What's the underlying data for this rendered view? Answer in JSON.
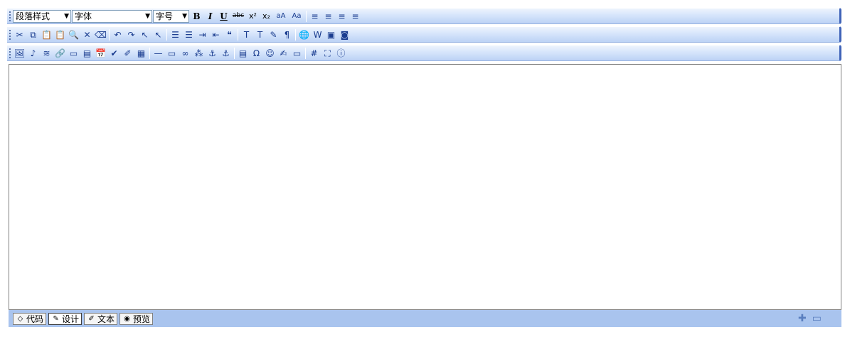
{
  "toolbar1": {
    "paragraph_style": "段落样式",
    "font": "字体",
    "font_size": "字号",
    "buttons": [
      {
        "name": "bold",
        "glyph": "B"
      },
      {
        "name": "italic",
        "glyph": "I"
      },
      {
        "name": "underline",
        "glyph": "U"
      },
      {
        "name": "strikethrough",
        "glyph": "abc"
      },
      {
        "name": "superscript",
        "glyph": "x²"
      },
      {
        "name": "subscript",
        "glyph": "x₂"
      },
      {
        "name": "font-color",
        "glyph": "aA"
      },
      {
        "name": "highlight",
        "glyph": "Aa"
      },
      {
        "name": "align-left",
        "glyph": "≡"
      },
      {
        "name": "align-center",
        "glyph": "≡"
      },
      {
        "name": "align-right",
        "glyph": "≡"
      },
      {
        "name": "align-justify",
        "glyph": "≡"
      }
    ]
  },
  "toolbar2": {
    "buttons": [
      {
        "name": "cut",
        "glyph": "✂"
      },
      {
        "name": "copy",
        "glyph": "⧉"
      },
      {
        "name": "paste",
        "glyph": "📋"
      },
      {
        "name": "paste-text",
        "glyph": "📋"
      },
      {
        "name": "find",
        "glyph": "🔍"
      },
      {
        "name": "delete",
        "glyph": "✕"
      },
      {
        "name": "eraser",
        "glyph": "⌫"
      },
      {
        "name": "undo",
        "glyph": "↶"
      },
      {
        "name": "redo",
        "glyph": "↷"
      },
      {
        "name": "select-all",
        "glyph": "↖"
      },
      {
        "name": "deselect",
        "glyph": "↖"
      },
      {
        "name": "ordered-list",
        "glyph": "☰"
      },
      {
        "name": "unordered-list",
        "glyph": "☰"
      },
      {
        "name": "indent",
        "glyph": "⇥"
      },
      {
        "name": "outdent",
        "glyph": "⇤"
      },
      {
        "name": "block-quote",
        "glyph": "❝"
      },
      {
        "name": "text-color",
        "glyph": "T"
      },
      {
        "name": "bg-color",
        "glyph": "T"
      },
      {
        "name": "format-painter",
        "glyph": "✎"
      },
      {
        "name": "paragraph-props",
        "glyph": "¶"
      },
      {
        "name": "web-globe",
        "glyph": "🌐"
      },
      {
        "name": "clean-word",
        "glyph": "W"
      },
      {
        "name": "image-insert",
        "glyph": "▣"
      },
      {
        "name": "flash-insert",
        "glyph": "◙"
      }
    ]
  },
  "toolbar3": {
    "buttons": [
      {
        "name": "image",
        "glyph": "🖼"
      },
      {
        "name": "media",
        "glyph": "♪"
      },
      {
        "name": "flash",
        "glyph": "≋"
      },
      {
        "name": "attachment",
        "glyph": "🔗"
      },
      {
        "name": "frame",
        "glyph": "▭"
      },
      {
        "name": "form",
        "glyph": "▤"
      },
      {
        "name": "date",
        "glyph": "📅"
      },
      {
        "name": "spell-check",
        "glyph": "✔"
      },
      {
        "name": "marker",
        "glyph": "✐"
      },
      {
        "name": "template",
        "glyph": "▦"
      },
      {
        "name": "horizontal-rule",
        "glyph": "—"
      },
      {
        "name": "textbox",
        "glyph": "▭"
      },
      {
        "name": "link",
        "glyph": "∞"
      },
      {
        "name": "unlink",
        "glyph": "⁂"
      },
      {
        "name": "bookmark",
        "glyph": "⚓"
      },
      {
        "name": "anchor",
        "glyph": "⚓"
      },
      {
        "name": "page-break",
        "glyph": "▤"
      },
      {
        "name": "special-char",
        "glyph": "Ω"
      },
      {
        "name": "emoticon",
        "glyph": "☺"
      },
      {
        "name": "signature",
        "glyph": "✍"
      },
      {
        "name": "screenshot",
        "glyph": "▭"
      },
      {
        "name": "table",
        "glyph": "#"
      },
      {
        "name": "fullscreen",
        "glyph": "⛶"
      },
      {
        "name": "about",
        "glyph": "ⓘ"
      }
    ]
  },
  "status": {
    "modes": [
      {
        "name": "code",
        "label": "代码",
        "glyph": "◇",
        "active": false
      },
      {
        "name": "design",
        "label": "设计",
        "glyph": "✎",
        "active": true
      },
      {
        "name": "text",
        "label": "文本",
        "glyph": "✐",
        "active": false
      },
      {
        "name": "preview",
        "label": "预览",
        "glyph": "◉",
        "active": false
      }
    ],
    "enlarge_glyph": "✚",
    "shrink_glyph": "▭"
  },
  "colors": {
    "toolbar_top": "#eef4fd",
    "toolbar_bottom": "#bcd2f5",
    "toolbar_edge": "#3f63b8",
    "statusbar": "#a9c4ee"
  }
}
